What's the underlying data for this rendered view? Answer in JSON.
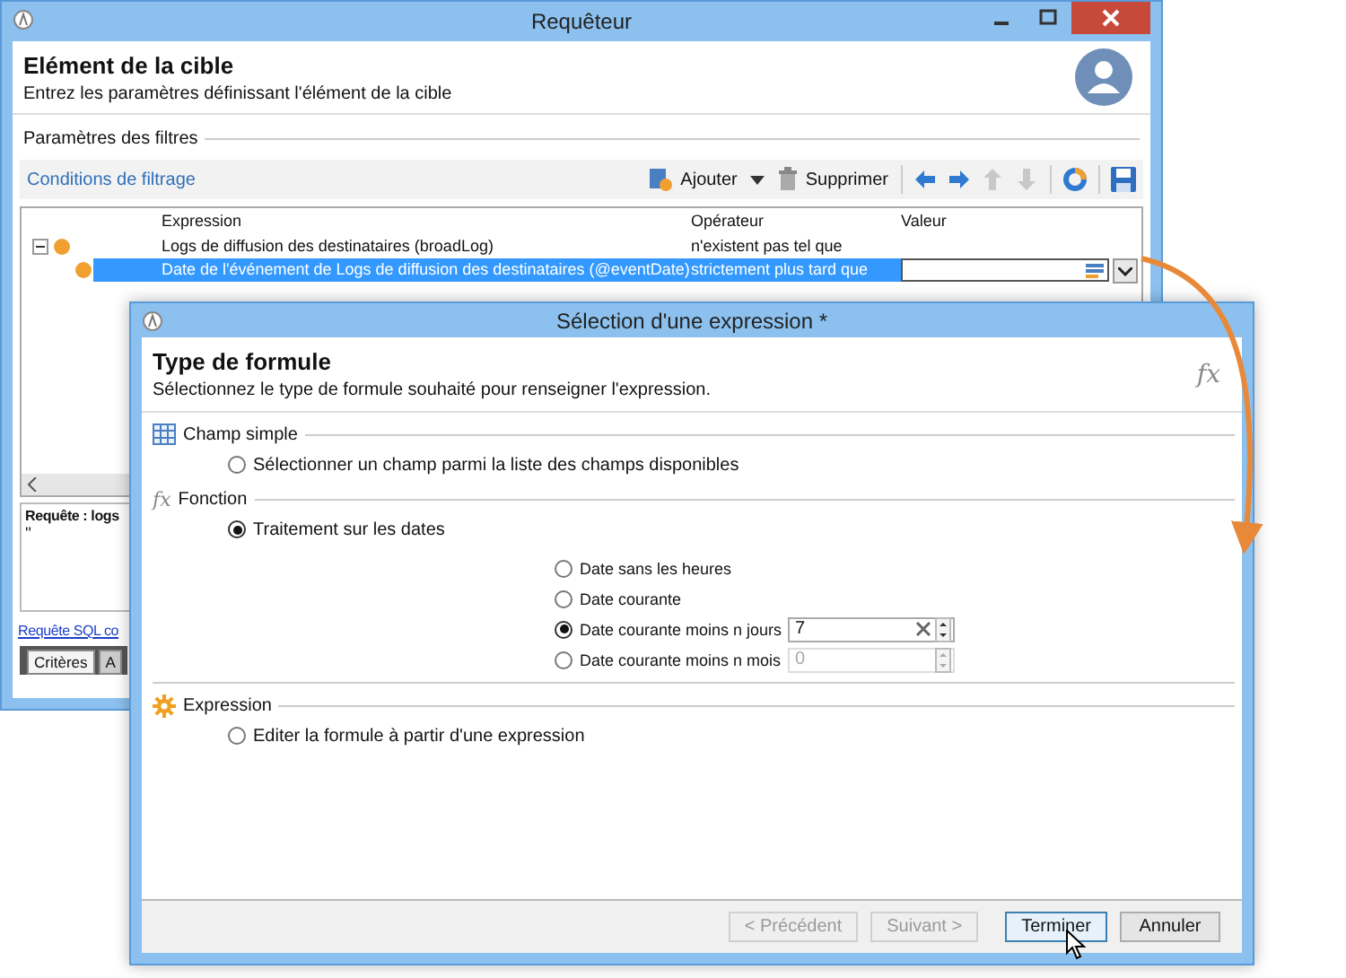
{
  "main_window": {
    "title": "Requêteur",
    "header": {
      "title": "Elément de la cible",
      "subtitle": "Entrez les paramètres définissant l'élément de la cible"
    },
    "group_label": "Paramètres des filtres",
    "toolbar": {
      "title": "Conditions de filtrage",
      "add_label": "Ajouter",
      "delete_label": "Supprimer",
      "nav_buttons": [
        {
          "kind": "left",
          "disabled": false
        },
        {
          "kind": "right",
          "disabled": false
        },
        {
          "kind": "up",
          "disabled": true
        },
        {
          "kind": "down",
          "disabled": true
        }
      ]
    },
    "table": {
      "columns": [
        "Expression",
        "Opérateur",
        "Valeur"
      ],
      "rows": [
        {
          "expression": "Logs de diffusion des destinataires (broadLog)",
          "operator": "n'existent pas tel que",
          "selected": false,
          "expanded": true,
          "children": [
            {
              "expression": "Date de l'événement de Logs de diffusion des destinataires (@eventDate)",
              "operator": "strictement plus tard que",
              "selected": true
            }
          ]
        }
      ]
    },
    "query_label": "Requête : logs",
    "query_text": "''",
    "sql_link": "Requête SQL co",
    "tabs": [
      {
        "label": "Critères",
        "selected": true
      },
      {
        "label": "A",
        "selected": false
      }
    ]
  },
  "dialog": {
    "title": "Sélection d'une expression *",
    "header": {
      "title": "Type de formule",
      "subtitle": "Sélectionnez le type de formule souhaité pour renseigner l'expression.",
      "symbol": "fx"
    },
    "sections": [
      {
        "kind": "grid",
        "label": "Champ simple",
        "options": [
          {
            "label": "Sélectionner un champ parmi la liste des champs disponibles",
            "selected": false
          }
        ]
      },
      {
        "kind": "function",
        "symbol": "fx",
        "label": "Fonction",
        "options": [
          {
            "label": "Traitement sur les dates",
            "selected": true,
            "sub_options": [
              {
                "label": "Date sans les heures",
                "selected": false
              },
              {
                "label": "Date courante",
                "selected": false
              },
              {
                "label": "Date courante moins n jours",
                "selected": true,
                "field": {
                  "value": "7",
                  "disabled": false
                }
              },
              {
                "label": "Date courante moins n mois",
                "selected": false,
                "field": {
                  "value": "0",
                  "disabled": true
                }
              }
            ]
          }
        ]
      },
      {
        "kind": "gear",
        "label": "Expression",
        "options": [
          {
            "label": "Editer la formule à partir d'une expression",
            "selected": false
          }
        ]
      }
    ],
    "buttons": [
      {
        "label": "< Précédent",
        "disabled": true,
        "focused": false
      },
      {
        "label": "Suivant >",
        "disabled": true,
        "focused": false
      },
      {
        "label": "Terminer",
        "disabled": false,
        "focused": true
      },
      {
        "label": "Annuler",
        "disabled": false,
        "focused": false
      }
    ]
  }
}
